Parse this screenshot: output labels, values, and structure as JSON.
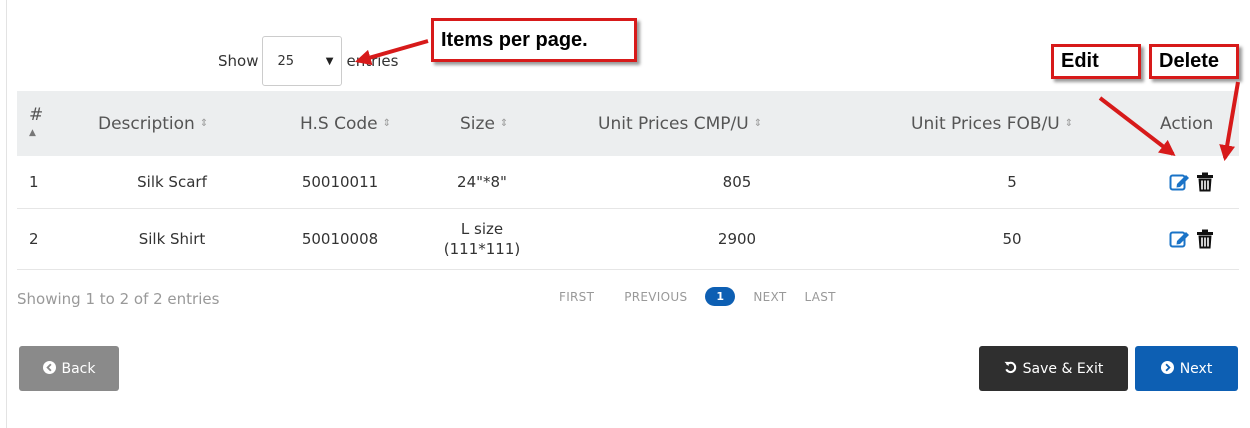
{
  "length_control": {
    "show_label": "Show",
    "selected": "25",
    "entries_label": "entries"
  },
  "table": {
    "headers": [
      "#",
      "Description",
      "H.S Code",
      "Size",
      "Unit Prices CMP/U",
      "Unit Prices FOB/U",
      "Action"
    ],
    "sort_icon": "⇕",
    "rows": [
      {
        "num": "1",
        "description": "Silk Scarf",
        "hs_code": "50010011",
        "size_line1": "24\"*8\"",
        "size_line2": "",
        "cmp": "805",
        "fob": "5"
      },
      {
        "num": "2",
        "description": "Silk Shirt",
        "hs_code": "50010008",
        "size_line1": "L size",
        "size_line2": "(111*111)",
        "cmp": "2900",
        "fob": "50"
      }
    ]
  },
  "info": "Showing 1 to 2 of 2 entries",
  "pagination": {
    "first": "FIRST",
    "previous": "PREVIOUS",
    "current": "1",
    "next": "NEXT",
    "last": "LAST"
  },
  "buttons": {
    "back": "Back",
    "save_exit": "Save & Exit",
    "next": "Next"
  },
  "annotations": {
    "items_per_page": "Items per page.",
    "edit": "Edit",
    "delete": "Delete"
  },
  "colors": {
    "primary": "#0d5fb3",
    "annotation": "#d71a1a",
    "header_bg": "#eceeef",
    "edit_icon": "#1a73c7"
  },
  "icons": {
    "edit": "edit-icon",
    "delete": "trash-icon",
    "back": "circle-arrow-left-icon",
    "save": "undo-icon",
    "next": "circle-arrow-right-icon"
  }
}
